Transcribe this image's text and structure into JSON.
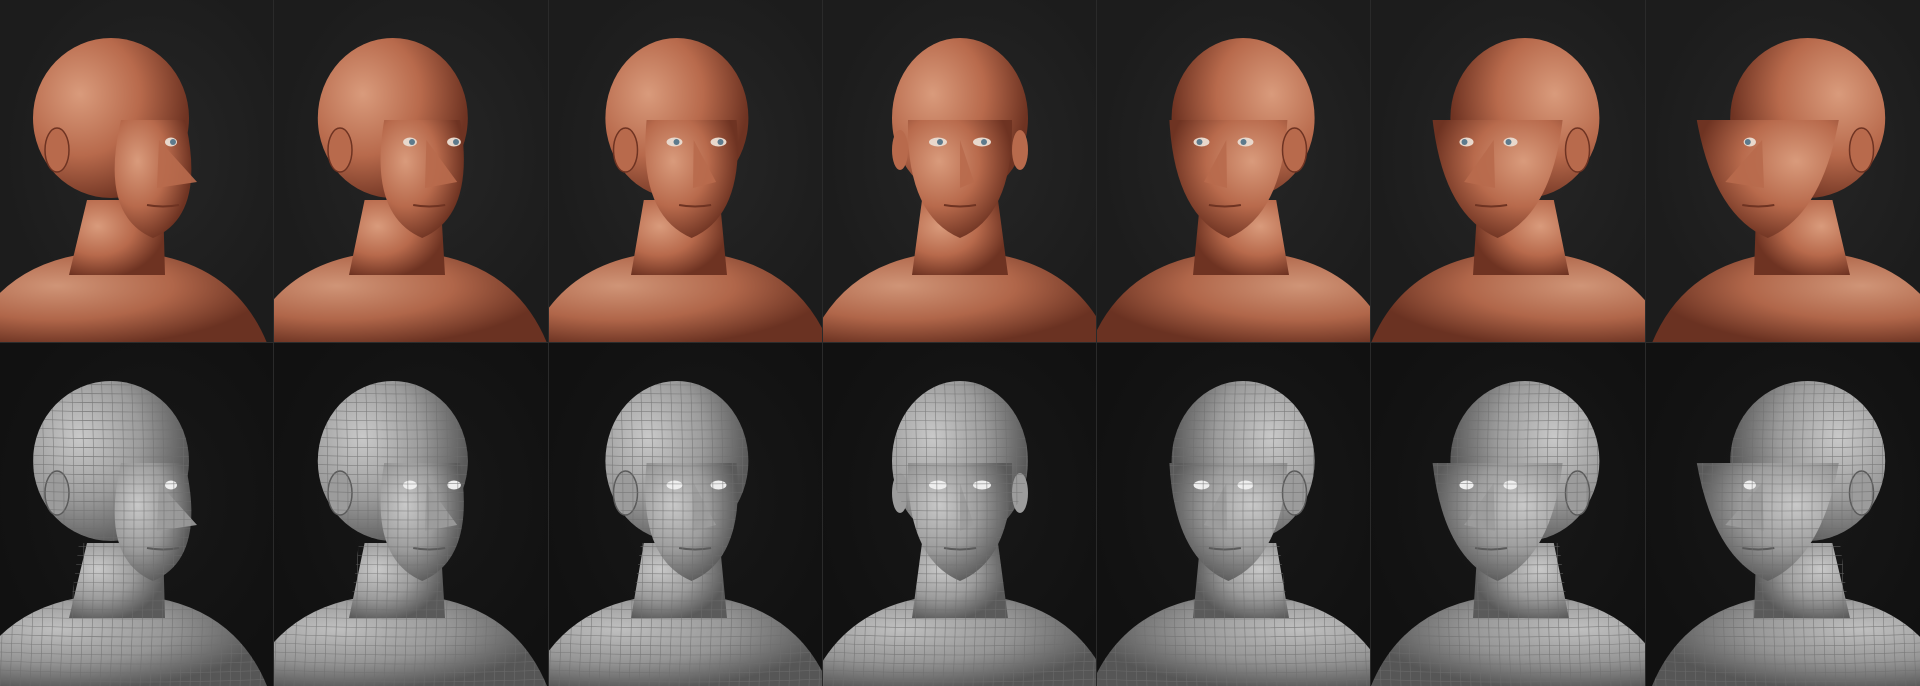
{
  "sheet": {
    "rows": [
      {
        "id": "textured",
        "style": "skin",
        "views": [
          {
            "view": "profile-right-back",
            "yaw": 100
          },
          {
            "view": "three-quarter-right-back",
            "yaw": 70
          },
          {
            "view": "three-quarter-right",
            "yaw": 35
          },
          {
            "view": "front",
            "yaw": 0
          },
          {
            "view": "three-quarter-left",
            "yaw": -35
          },
          {
            "view": "three-quarter-left-far",
            "yaw": -65
          },
          {
            "view": "profile-left",
            "yaw": -95
          }
        ]
      },
      {
        "id": "wireframe",
        "style": "mesh",
        "views": [
          {
            "view": "profile-right-back",
            "yaw": 100
          },
          {
            "view": "three-quarter-right-back",
            "yaw": 70
          },
          {
            "view": "three-quarter-right",
            "yaw": 35
          },
          {
            "view": "front",
            "yaw": 0
          },
          {
            "view": "three-quarter-left",
            "yaw": -35
          },
          {
            "view": "three-quarter-left-far",
            "yaw": -65
          },
          {
            "view": "profile-left",
            "yaw": -95
          }
        ]
      }
    ],
    "colors": {
      "skin_light": "#d99b7c",
      "skin_mid": "#b86a4c",
      "skin_dark": "#6e3322",
      "mesh_light": "#c9c9c9",
      "mesh_mid": "#9c9c9c",
      "mesh_dark": "#5a5a5a",
      "mesh_line": "#6f6f6f",
      "bg_top": "#202020",
      "bg_bottom": "#141414"
    }
  }
}
